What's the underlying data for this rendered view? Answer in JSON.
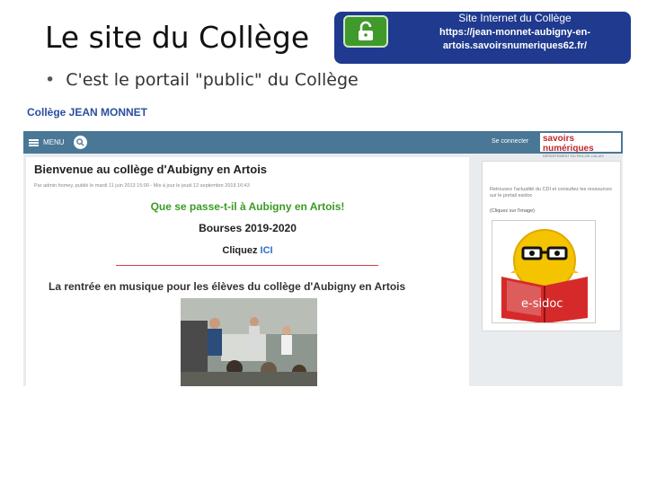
{
  "slide": {
    "title": "Le site du Collège",
    "bullet": "C'est le portail \"public\" du Collège"
  },
  "info_box": {
    "title": "Site Internet du Collège",
    "url": "https://jean-monnet-aubigny-en-artois.savoirsnumeriques62.fr/",
    "icon": "open-lock-icon"
  },
  "website": {
    "college_name": "Collège JEAN MONNET",
    "navbar": {
      "menu_label": "MENU",
      "login_label": "Se connecter",
      "brand_name": "savoirs numériques",
      "brand_sub": "DÉPARTEMENT DU PAS-DE-CALAIS",
      "color": "#4a7796"
    },
    "article": {
      "title": "Bienvenue au collège d'Aubigny en Artois",
      "byline": "Par admin homey, publié le mardi 11 juin 2013 15:00 - Mis à jour le jeudi 12 septembre 2019 16:43",
      "headline_green": "Que se passe-t-il  à Aubigny en Artois!",
      "headline_bourses": "Bourses 2019-2020",
      "click_prefix": "Cliquez ",
      "click_link": "ICI",
      "rentree": "La rentrée en musique pour les élèves du collège d'Aubigny en Artois"
    },
    "sidebar": {
      "text": "Retrouvez l'actualité du CDI et consultez les ressources sur le portail esidoc",
      "caption": "(Cliquez sur l'image)",
      "esidoc_label": "e-sidoc"
    }
  },
  "colors": {
    "info_box": "#1f3a8e",
    "green_headline": "#3a9a24",
    "link_blue": "#2d6fd6",
    "brand_red": "#c2272d"
  }
}
